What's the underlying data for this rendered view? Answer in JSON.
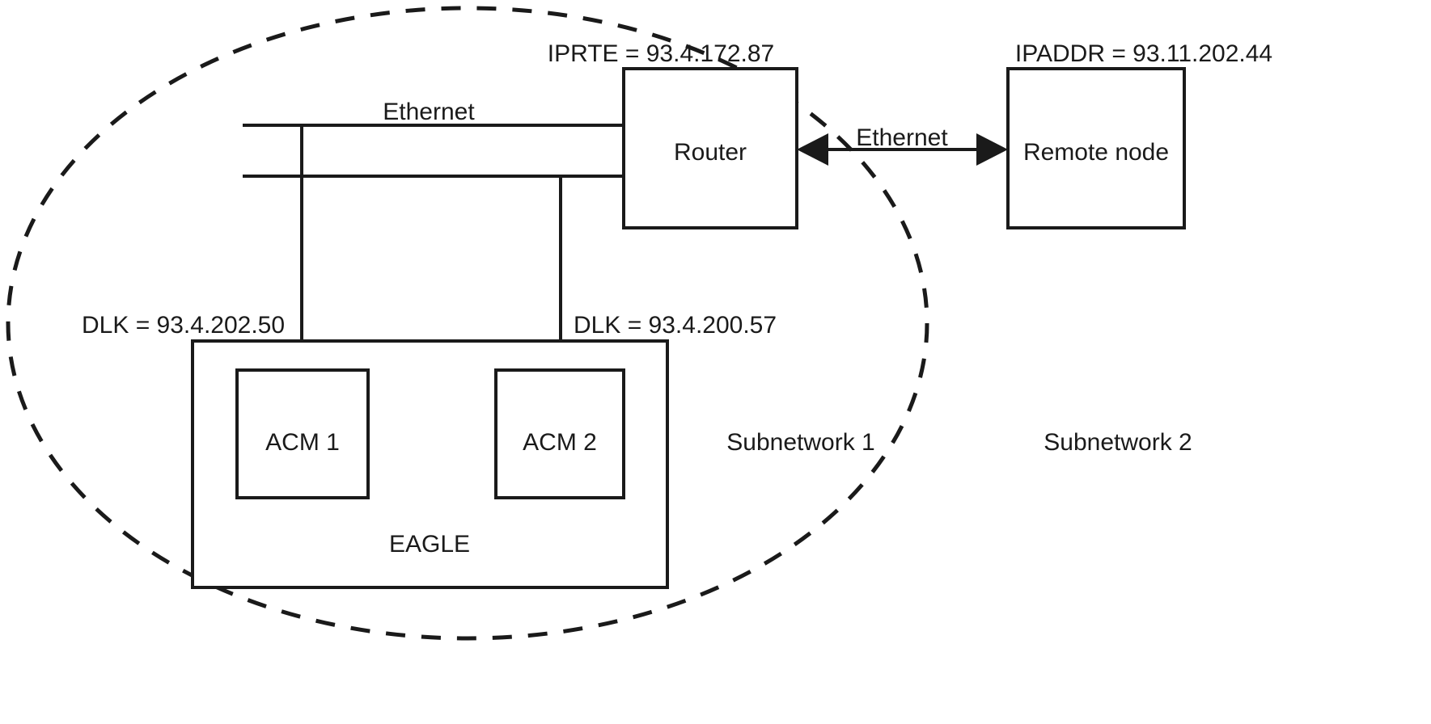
{
  "diagram": {
    "title": "IP networking diagram with EAGLE, Router and Remote node",
    "colors": {
      "stroke": "#1a1a1a",
      "fill": "#ffffff",
      "background": "#ffffff"
    },
    "nodes": {
      "router": {
        "label": "Router",
        "address_label": "IPRTE = 93.4.172.87"
      },
      "remote_node": {
        "label": "Remote node",
        "address_label": "IPADDR = 93.11.202.44"
      },
      "eagle": {
        "label": "EAGLE"
      },
      "acm1": {
        "label": "ACM 1",
        "address_label": "DLK = 93.4.202.50"
      },
      "acm2": {
        "label": "ACM 2",
        "address_label": "DLK = 93.4.200.57"
      }
    },
    "links": {
      "lan_ethernet_label": "Ethernet",
      "wan_ethernet_label": "Ethernet"
    },
    "regions": {
      "subnetwork1": "Subnetwork 1",
      "subnetwork2": "Subnetwork 2"
    }
  }
}
